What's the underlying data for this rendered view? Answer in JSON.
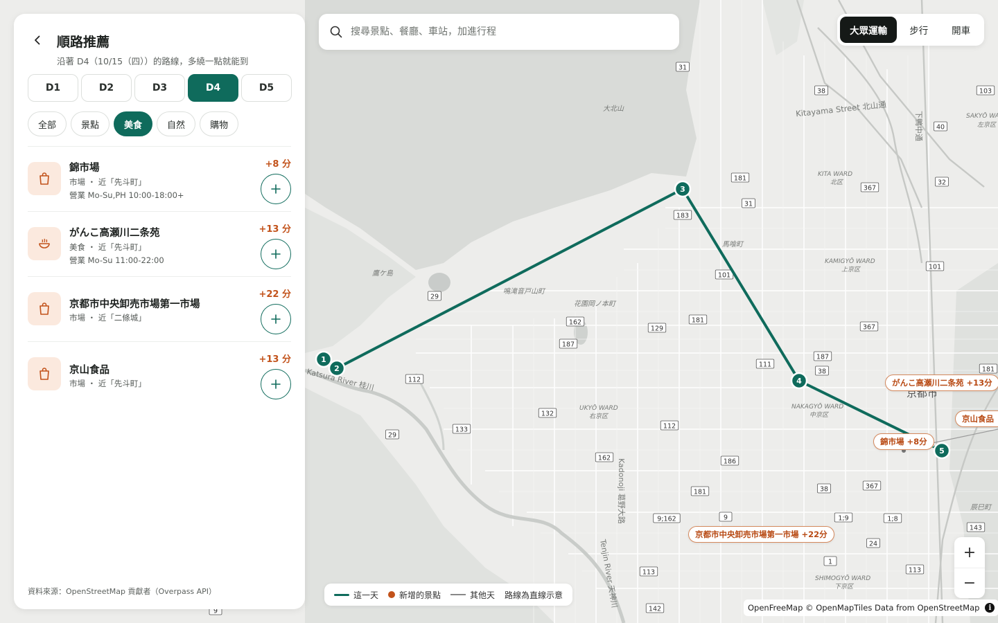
{
  "panel": {
    "title": "順路推薦",
    "subtitle": "沿著 D4（10/15（四））的路線，多繞一點就能到",
    "day_tabs": [
      {
        "label": "D1",
        "active": false
      },
      {
        "label": "D2",
        "active": false
      },
      {
        "label": "D3",
        "active": false
      },
      {
        "label": "D4",
        "active": true
      },
      {
        "label": "D5",
        "active": false
      }
    ],
    "category_tabs": [
      {
        "label": "全部",
        "active": false
      },
      {
        "label": "景點",
        "active": false
      },
      {
        "label": "美食",
        "active": true
      },
      {
        "label": "自然",
        "active": false
      },
      {
        "label": "購物",
        "active": false
      }
    ],
    "items": [
      {
        "name": "錦市場",
        "meta": "市場 ・ 近「先斗町」",
        "hours": "營業 Mo-Su,PH 10:00-18:00+",
        "delta": "+8 分",
        "icon": "shopping-bag-icon"
      },
      {
        "name": "がんこ高瀬川二条苑",
        "meta": "美食 ・ 近「先斗町」",
        "hours": "營業 Mo-Su 11:00-22:00",
        "delta": "+13 分",
        "icon": "bowl-icon"
      },
      {
        "name": "京都市中央卸売市場第一市場",
        "meta": "市場 ・ 近「二條城」",
        "hours": "",
        "delta": "+22 分",
        "icon": "shopping-bag-icon"
      },
      {
        "name": "京山食品",
        "meta": "市場 ・ 近「先斗町」",
        "hours": "",
        "delta": "+13 分",
        "icon": "shopping-bag-icon"
      }
    ],
    "source_note": "資料來源：OpenStreetMap 貢獻者（Overpass API）"
  },
  "search": {
    "placeholder": "搜尋景點、餐廳、車站，加進行程"
  },
  "modes": [
    {
      "label": "大眾運輸",
      "active": true
    },
    {
      "label": "步行",
      "active": false
    },
    {
      "label": "開車",
      "active": false
    }
  ],
  "zoom": {
    "in": "+",
    "out": "−"
  },
  "legend": {
    "this_day": "這一天",
    "added": "新增的景點",
    "other_days": "其他天",
    "note": "路線為直線示意"
  },
  "attribution": {
    "text": "OpenFreeMap © OpenMapTiles Data from OpenStreetMap",
    "info": "i"
  },
  "colors": {
    "primary": "#0f6b5c",
    "accent": "#c2521a",
    "icon_bg": "#fbe9de"
  },
  "map": {
    "route_stops": [
      "1",
      "2",
      "3",
      "4",
      "5"
    ],
    "callouts": [
      {
        "label": "がんこ高瀬川二条苑 +13分"
      },
      {
        "label": "京山食品"
      },
      {
        "label": "錦市場 +8分"
      },
      {
        "label": "京都市中央卸売市場第一市場 +22分"
      }
    ],
    "place_labels": [
      "大北山",
      "Kitayama Street 北山通",
      "KITA WARD",
      "北区",
      "KAMIGYŌ WARD",
      "上京区",
      "鷹ケ島",
      "鳴滝音戸山町",
      "花園岡ノ本町",
      "馬喰町",
      "UKYŌ WARD",
      "右京区",
      "NAKAGYŌ WARD",
      "中京区",
      "京都市",
      "SAKYŌ WARD",
      "左京区",
      "SHIMOGYŌ WARD",
      "下京区",
      "Kadonoji 葛野大路",
      "Tenjin River 天神川",
      "辰巳町",
      "下鴨中通",
      "Katsura River 桂川"
    ],
    "road_numbers": [
      "31",
      "38",
      "103",
      "40",
      "181",
      "367",
      "32",
      "31",
      "183",
      "101",
      "101",
      "29",
      "181",
      "162",
      "129",
      "367",
      "187",
      "187",
      "111",
      "38",
      "181",
      "112",
      "132",
      "133",
      "29",
      "112",
      "162",
      "186",
      "38",
      "367",
      "181",
      "9;162",
      "9",
      "1;9",
      "1;8",
      "143",
      "24",
      "1",
      "113",
      "113",
      "142",
      "9"
    ]
  }
}
